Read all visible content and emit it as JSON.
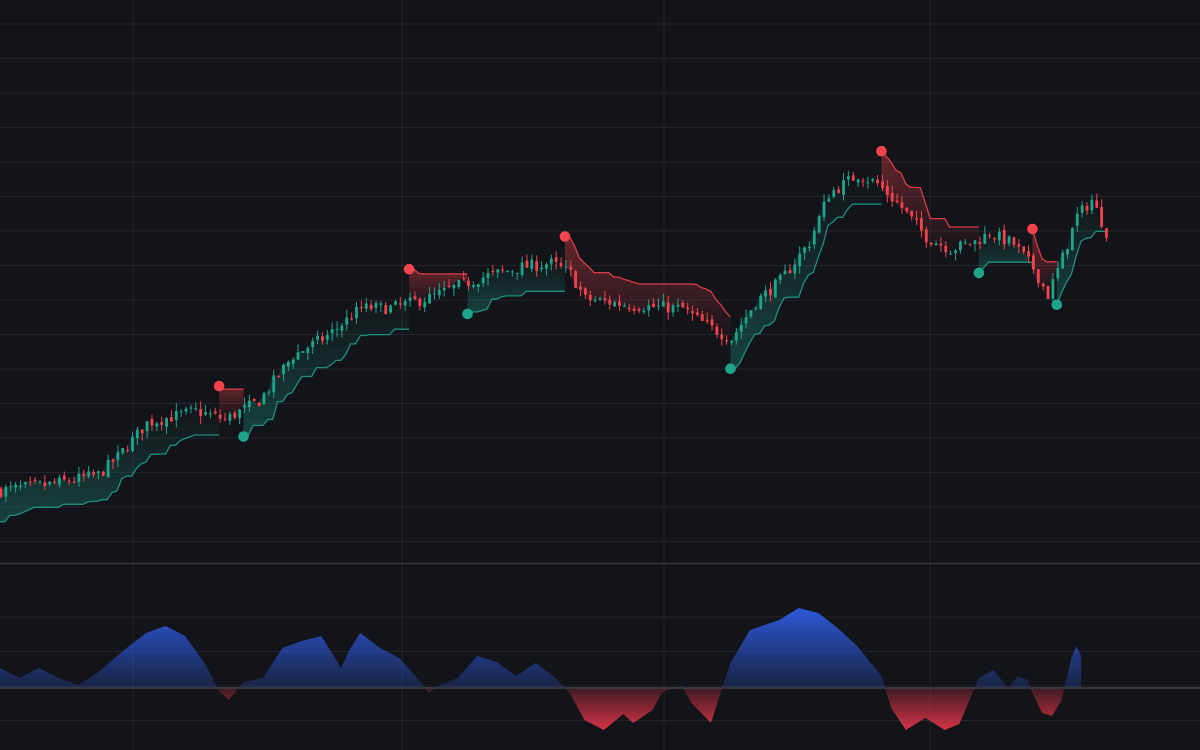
{
  "colors": {
    "background": "#131419",
    "grid": "#23252c",
    "pane_divider": "#34363d",
    "zero_line": "#3e4048",
    "bull": "#1fa58b",
    "bear": "#f2434f",
    "osc_positive": "#2f5ee8",
    "osc_negative": "#e8374a"
  },
  "chart_data": [
    {
      "type": "candlestick",
      "title": "",
      "grid": true,
      "legend": "none",
      "x": {
        "range": [
          0,
          227
        ],
        "tick_labels": []
      },
      "y": {
        "range": [
          0,
          100
        ],
        "tick_labels": []
      },
      "price_path_anchors": [
        [
          0,
          12.4
        ],
        [
          10,
          13.5
        ],
        [
          20,
          15.2
        ],
        [
          24,
          18.4
        ],
        [
          30,
          24.5
        ],
        [
          40,
          26.6
        ],
        [
          46,
          25.1
        ],
        [
          53,
          28.4
        ],
        [
          60,
          36.5
        ],
        [
          67,
          40.0
        ],
        [
          74,
          45.0
        ],
        [
          80,
          45.0
        ],
        [
          88,
          46.8
        ],
        [
          94,
          49.0
        ],
        [
          100,
          50.8
        ],
        [
          107,
          52.3
        ],
        [
          113,
          53.0
        ],
        [
          117,
          51.1
        ],
        [
          120,
          46.6
        ],
        [
          130,
          45.4
        ],
        [
          140,
          44.9
        ],
        [
          145,
          41.8
        ],
        [
          150,
          39.5
        ],
        [
          155,
          46.1
        ],
        [
          160,
          49.8
        ],
        [
          166,
          56.7
        ],
        [
          170,
          65.4
        ],
        [
          176,
          68.8
        ],
        [
          180,
          67.2
        ],
        [
          185,
          62.9
        ],
        [
          190,
          57.7
        ],
        [
          195,
          55.5
        ],
        [
          200,
          56.8
        ],
        [
          203,
          58.4
        ],
        [
          208,
          56.4
        ],
        [
          212,
          52.1
        ],
        [
          215,
          47.3
        ],
        [
          218,
          54.0
        ],
        [
          221,
          61.4
        ],
        [
          224,
          64.3
        ],
        [
          227,
          58.6
        ]
      ],
      "trailing_band_segments": [
        {
          "trend": "up",
          "from": 0,
          "to": 45
        },
        {
          "trend": "down",
          "from": 45,
          "to": 50
        },
        {
          "trend": "up",
          "from": 50,
          "to": 84
        },
        {
          "trend": "down",
          "from": 84,
          "to": 96
        },
        {
          "trend": "up",
          "from": 96,
          "to": 116
        },
        {
          "trend": "down",
          "from": 116,
          "to": 150
        },
        {
          "trend": "up",
          "from": 150,
          "to": 181
        },
        {
          "trend": "down",
          "from": 181,
          "to": 201
        },
        {
          "trend": "up",
          "from": 201,
          "to": 212
        },
        {
          "trend": "down",
          "from": 212,
          "to": 217
        },
        {
          "trend": "up",
          "from": 217,
          "to": 227
        }
      ],
      "signals": [
        {
          "type": "sell",
          "index": 45
        },
        {
          "type": "buy",
          "index": 50
        },
        {
          "type": "sell",
          "index": 84
        },
        {
          "type": "buy",
          "index": 96
        },
        {
          "type": "sell",
          "index": 116
        },
        {
          "type": "buy",
          "index": 150
        },
        {
          "type": "sell",
          "index": 181
        },
        {
          "type": "buy",
          "index": 201
        },
        {
          "type": "sell",
          "index": 212
        },
        {
          "type": "buy",
          "index": 217
        }
      ]
    },
    {
      "type": "area",
      "title": "",
      "grid": true,
      "legend": "none",
      "baseline": 0,
      "y": {
        "range": [
          -1,
          1
        ],
        "tick_labels": []
      },
      "oscillator_anchors": [
        [
          0,
          0.2
        ],
        [
          4,
          0.1
        ],
        [
          8,
          0.2
        ],
        [
          12,
          0.1
        ],
        [
          16,
          0.03
        ],
        [
          20,
          0.15
        ],
        [
          26,
          0.4
        ],
        [
          30,
          0.55
        ],
        [
          34,
          0.62
        ],
        [
          38,
          0.52
        ],
        [
          42,
          0.25
        ],
        [
          45,
          -0.03
        ],
        [
          47,
          -0.12
        ],
        [
          50,
          0.06
        ],
        [
          54,
          0.1
        ],
        [
          58,
          0.4
        ],
        [
          62,
          0.47
        ],
        [
          66,
          0.52
        ],
        [
          70,
          0.2
        ],
        [
          72,
          0.4
        ],
        [
          74,
          0.55
        ],
        [
          78,
          0.4
        ],
        [
          82,
          0.3
        ],
        [
          86,
          0.08
        ],
        [
          88,
          -0.05
        ],
        [
          90,
          0.02
        ],
        [
          94,
          0.1
        ],
        [
          98,
          0.32
        ],
        [
          102,
          0.26
        ],
        [
          106,
          0.12
        ],
        [
          110,
          0.25
        ],
        [
          114,
          0.1
        ],
        [
          117,
          -0.05
        ],
        [
          120,
          -0.32
        ],
        [
          124,
          -0.42
        ],
        [
          128,
          -0.26
        ],
        [
          130,
          -0.35
        ],
        [
          134,
          -0.22
        ],
        [
          136,
          -0.04
        ],
        [
          140,
          0.02
        ],
        [
          142,
          -0.15
        ],
        [
          146,
          -0.35
        ],
        [
          148,
          -0.04
        ],
        [
          150,
          0.25
        ],
        [
          154,
          0.58
        ],
        [
          160,
          0.68
        ],
        [
          164,
          0.8
        ],
        [
          168,
          0.75
        ],
        [
          172,
          0.6
        ],
        [
          176,
          0.42
        ],
        [
          181,
          0.12
        ],
        [
          183,
          -0.2
        ],
        [
          186,
          -0.42
        ],
        [
          190,
          -0.3
        ],
        [
          194,
          -0.42
        ],
        [
          197,
          -0.36
        ],
        [
          201,
          0.1
        ],
        [
          204,
          0.18
        ],
        [
          207,
          0.0
        ],
        [
          209,
          0.12
        ],
        [
          211,
          0.08
        ],
        [
          212,
          -0.05
        ],
        [
          214,
          -0.25
        ],
        [
          216,
          -0.28
        ],
        [
          218,
          -0.12
        ],
        [
          220,
          0.3
        ],
        [
          221,
          0.42
        ],
        [
          222,
          0.32
        ]
      ]
    }
  ]
}
